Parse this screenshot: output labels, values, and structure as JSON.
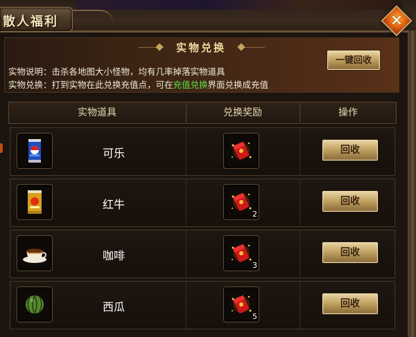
{
  "window": {
    "title": "散人福利",
    "close_icon": "close-icon"
  },
  "header": {
    "section_title": "实物兑换",
    "collect_all_label": "一键回收",
    "desc_line1": "实物说明：击杀各地图大小怪物，均有几率掉落实物道具",
    "desc_line2_prefix": "实物兑换：打到实物在此兑换充值点，可在",
    "desc_line2_link": "充值兑换",
    "desc_line2_suffix": "界面兑换成充值",
    "link_color": "#5ce04a"
  },
  "table": {
    "columns": [
      "实物道具",
      "兑换奖励",
      "操作"
    ],
    "rows": [
      {
        "item_icon": "cola-can-icon",
        "name": "可乐",
        "reward_icon": "red-envelope-icon",
        "reward_qty": "",
        "action_label": "回收"
      },
      {
        "item_icon": "energy-drink-can-icon",
        "name": "红牛",
        "reward_icon": "red-envelope-icon",
        "reward_qty": "2",
        "action_label": "回收"
      },
      {
        "item_icon": "coffee-cup-icon",
        "name": "咖啡",
        "reward_icon": "red-envelope-icon",
        "reward_qty": "3",
        "action_label": "回收"
      },
      {
        "item_icon": "watermelon-icon",
        "name": "西瓜",
        "reward_icon": "red-envelope-icon",
        "reward_qty": "5",
        "action_label": "回收"
      }
    ]
  }
}
